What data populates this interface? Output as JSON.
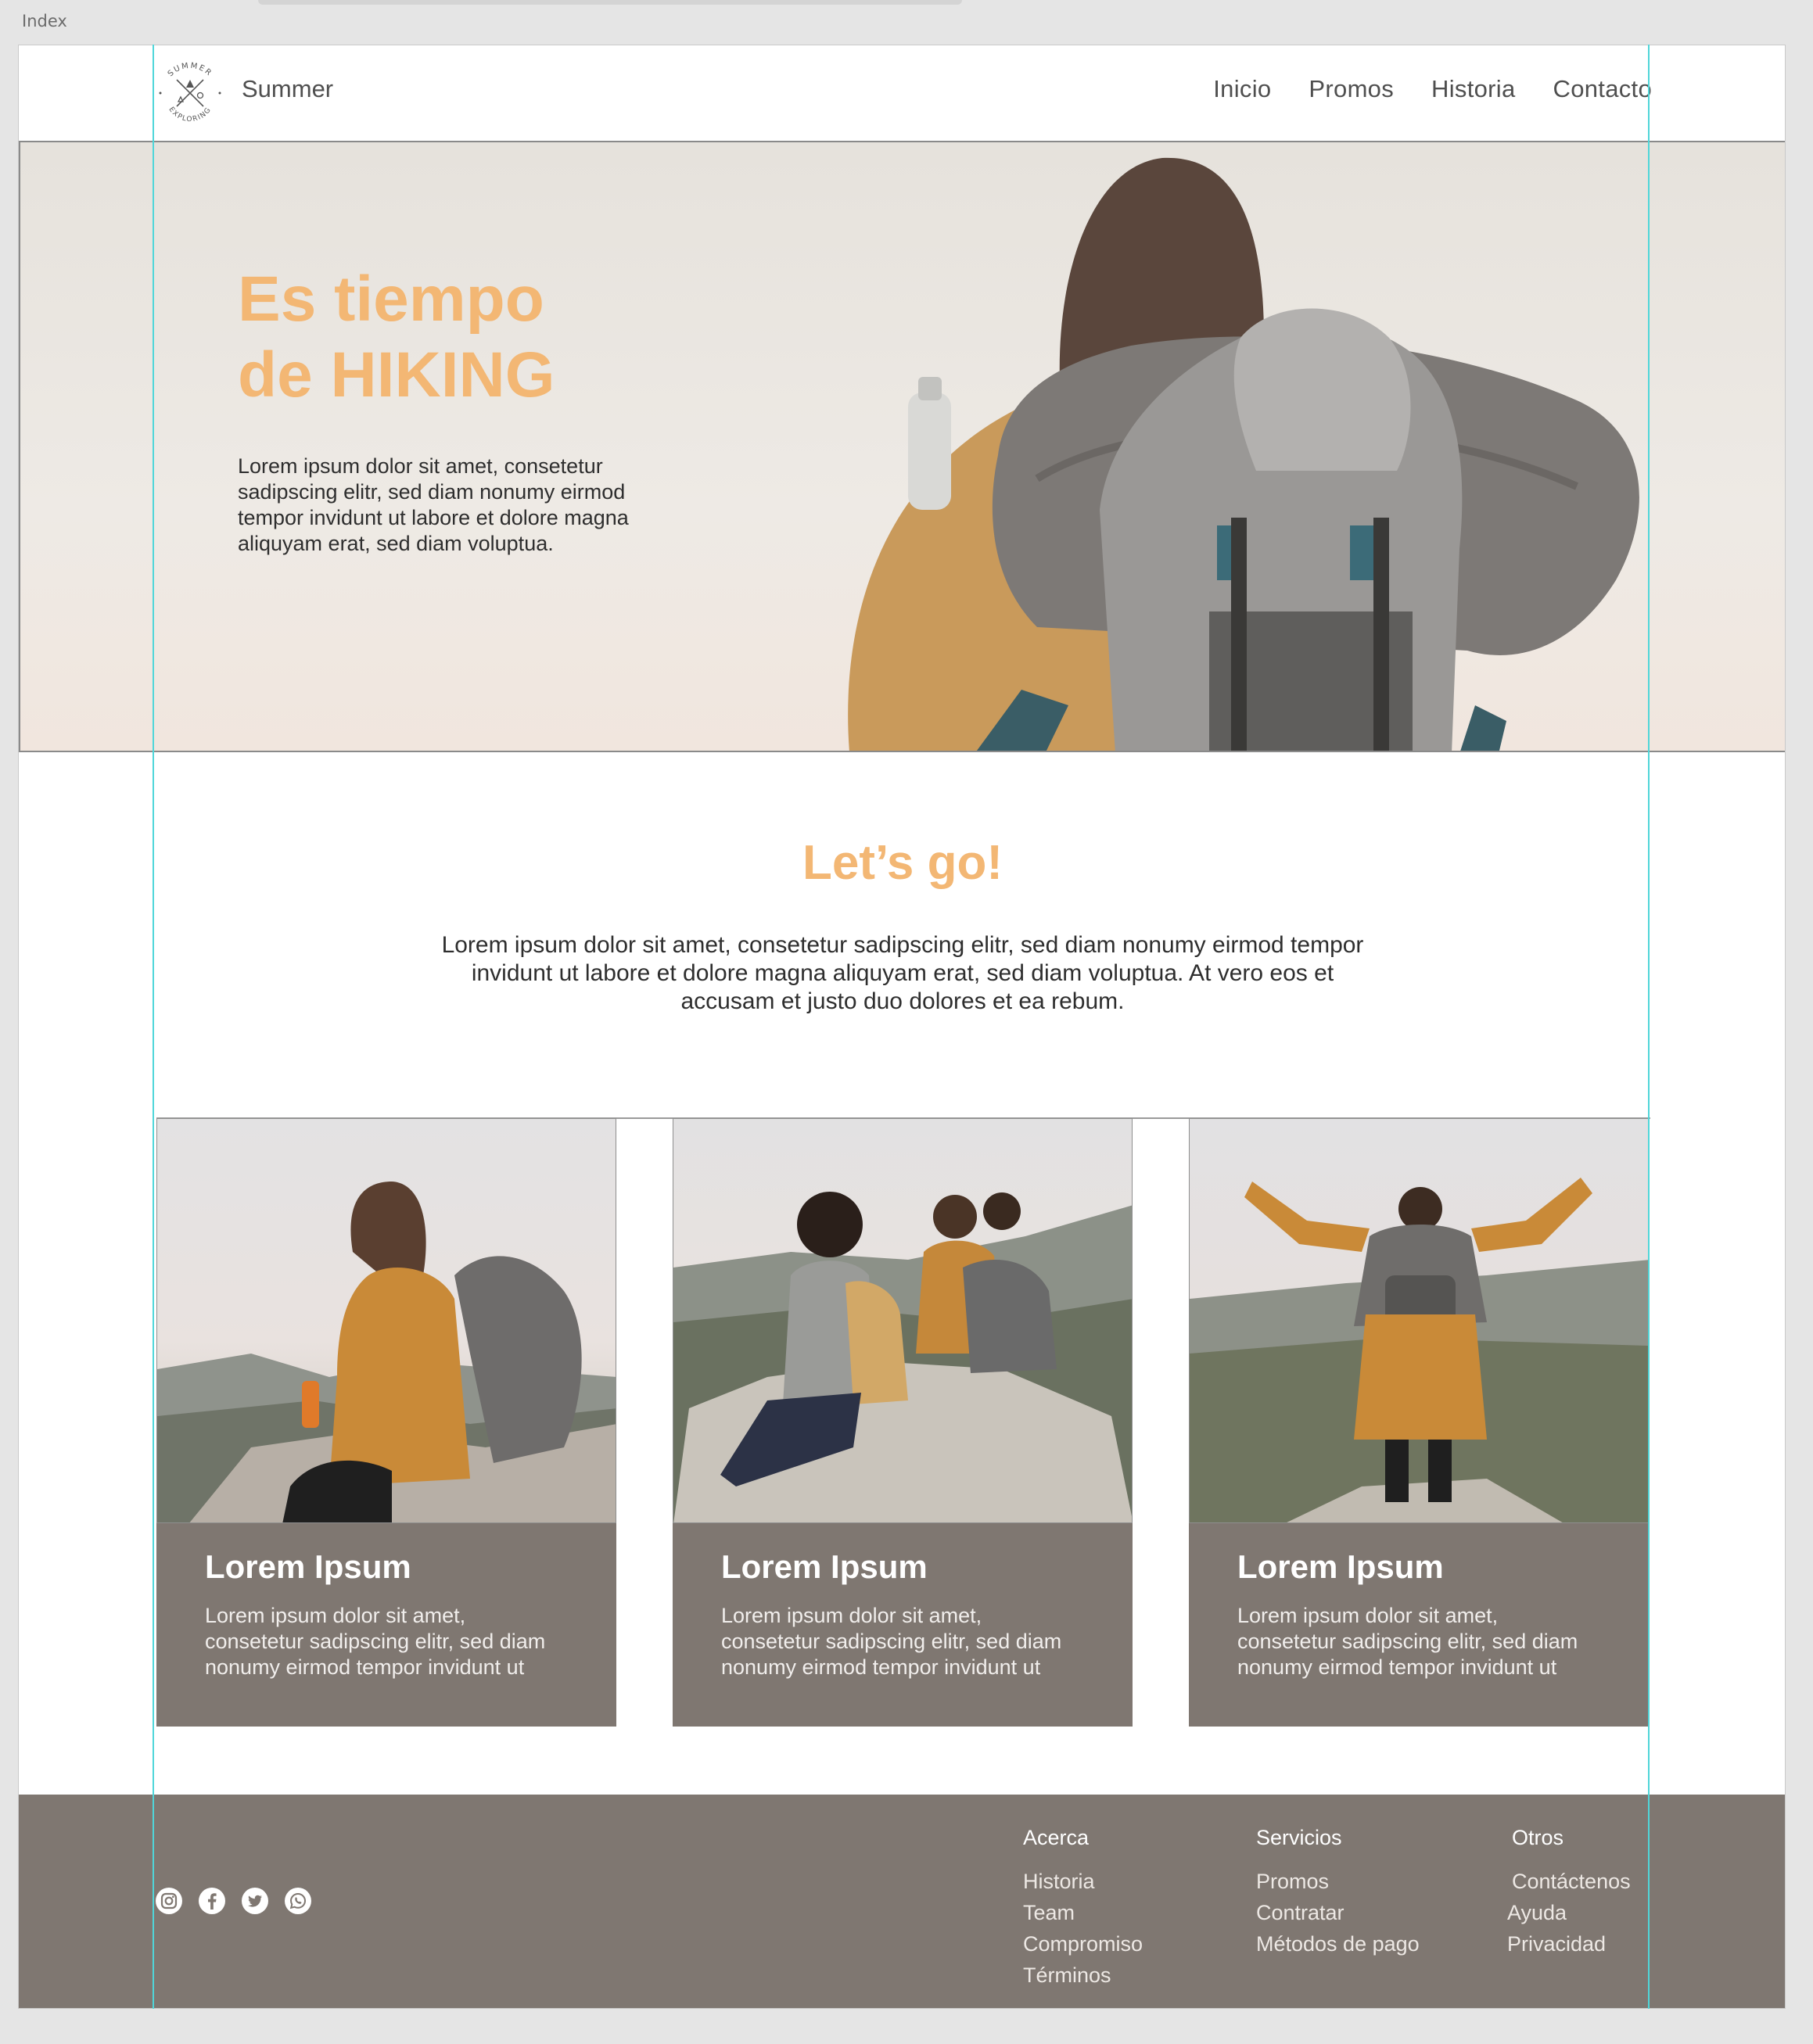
{
  "document": {
    "label": "Index"
  },
  "header": {
    "brand": "Summer",
    "logo_text_top": "SUMMER",
    "logo_text_bottom": "EXPLORING",
    "nav": [
      {
        "label": "Inicio"
      },
      {
        "label": "Promos"
      },
      {
        "label": "Historia"
      },
      {
        "label": "Contacto"
      }
    ]
  },
  "hero": {
    "title_line1": "Es tiempo",
    "title_line2": "de HIKING",
    "text": "Lorem ipsum dolor sit amet, consetetur sadipscing elitr, sed diam nonumy eirmod tempor invidunt ut labore et dolore magna aliquyam erat, sed diam voluptua."
  },
  "intro": {
    "title": "Let’s go!",
    "text": "Lorem ipsum dolor sit amet, consetetur sadipscing elitr, sed diam nonumy eirmod tempor invidunt ut labore et dolore magna aliquyam erat, sed diam voluptua. At vero eos et accusam et justo duo dolores et ea rebum."
  },
  "cards": [
    {
      "title": "Lorem Ipsum",
      "text": "Lorem ipsum dolor sit amet, consetetur sadipscing elitr, sed diam nonumy eirmod tempor invidunt ut"
    },
    {
      "title": "Lorem Ipsum",
      "text": "Lorem ipsum dolor sit amet, consetetur sadipscing elitr, sed diam nonumy eirmod tempor invidunt ut"
    },
    {
      "title": "Lorem Ipsum",
      "text": "Lorem ipsum dolor sit amet, consetetur sadipscing elitr, sed diam nonumy eirmod tempor invidunt ut"
    }
  ],
  "footer": {
    "social_icons": [
      "instagram-icon",
      "facebook-icon",
      "twitter-icon",
      "whatsapp-icon"
    ],
    "columns": [
      {
        "heading": "Acerca",
        "links": [
          "Historia",
          "Team",
          "Compromiso",
          "Términos"
        ]
      },
      {
        "heading": "Servicios",
        "links": [
          "Promos",
          "Contratar",
          "Métodos de pago"
        ]
      },
      {
        "heading": "Otros",
        "links": [
          "Contáctenos",
          "Ayuda",
          "Privacidad"
        ]
      }
    ]
  },
  "colors": {
    "accent": "#f3b774",
    "panel": "#7f7771",
    "guide": "#4fd6d9"
  }
}
